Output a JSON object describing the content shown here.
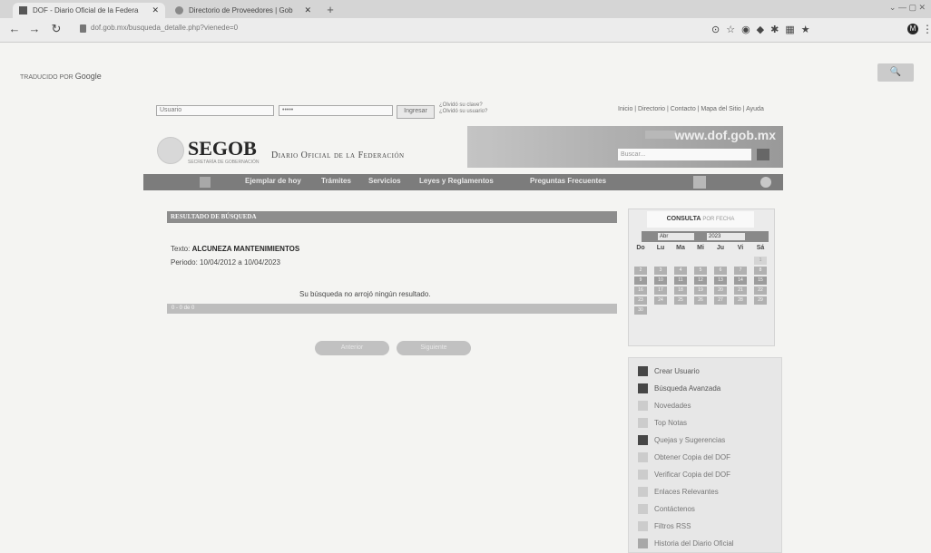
{
  "browser": {
    "tabs": [
      {
        "title": "DOF - Diario Oficial de la Federa"
      },
      {
        "title": "Directorio de Proveedores | Gob"
      }
    ],
    "new_tab": "+",
    "url": "dof.gob.mx/busqueda_detalle.php?vienede=0",
    "profile_letter": "M"
  },
  "translate": {
    "prefix": "TRADUCIDO POR",
    "brand": "Google",
    "button": "🔍"
  },
  "login": {
    "user_value": "Usuario",
    "pass_value": "•••••",
    "submit": "Ingresar",
    "forgot_pass": "¿Olvidó su clave?",
    "forgot_user": "¿Olvidó su usuario?"
  },
  "toplinks": "Inicio | Directorio | Contacto | Mapa del Sitio | Ayuda",
  "header": {
    "segob": "SEGOB",
    "segob_sub": "SECRETARÍA DE GOBERNACIÓN",
    "dof_title": "Diario Oficial de la Federación",
    "www": "www.dof.gob.mx",
    "search_placeholder": "Buscar..."
  },
  "menu": {
    "items": [
      "Ejemplar de hoy",
      "Trámites",
      "Servicios",
      "Leyes y Reglamentos",
      "Preguntas Frecuentes"
    ]
  },
  "results": {
    "heading": "RESULTADO DE BÚSQUEDA",
    "texto_label": "Texto:",
    "texto_value": "ALCUNEZA MANTENIMIENTOS",
    "periodo_label": "Periodo:",
    "periodo_value": "10/04/2012 a 10/04/2023",
    "no_result": "Su búsqueda no arrojó ningún resultado.",
    "footer": "0 - 0 de 0",
    "btn_prev": "Anterior",
    "btn_next": "Siguiente"
  },
  "calendar": {
    "tab_bold": "CONSULTA",
    "tab_light": "POR FECHA",
    "month": "Abr",
    "year": "2023",
    "dow": [
      "Do",
      "Lu",
      "Ma",
      "Mi",
      "Ju",
      "Vi",
      "Sá"
    ],
    "days": [
      "1",
      "2",
      "3",
      "4",
      "5",
      "6",
      "7",
      "8",
      "9",
      "10",
      "11",
      "12",
      "13",
      "14",
      "15",
      "16",
      "17",
      "18",
      "19",
      "20",
      "21",
      "22",
      "23",
      "24",
      "25",
      "26",
      "27",
      "28",
      "29",
      "30"
    ]
  },
  "sidebar": {
    "items": [
      {
        "label": "Crear Usuario"
      },
      {
        "label": "Búsqueda Avanzada"
      },
      {
        "label": "Novedades"
      },
      {
        "label": "Top Notas"
      },
      {
        "label": "Quejas y Sugerencias"
      },
      {
        "label": "Obtener Copia del DOF"
      },
      {
        "label": "Verificar Copia del DOF"
      },
      {
        "label": "Enlaces Relevantes"
      },
      {
        "label": "Contáctenos"
      },
      {
        "label": "Filtros RSS"
      },
      {
        "label": "Historia del Diario Oficial"
      }
    ]
  }
}
